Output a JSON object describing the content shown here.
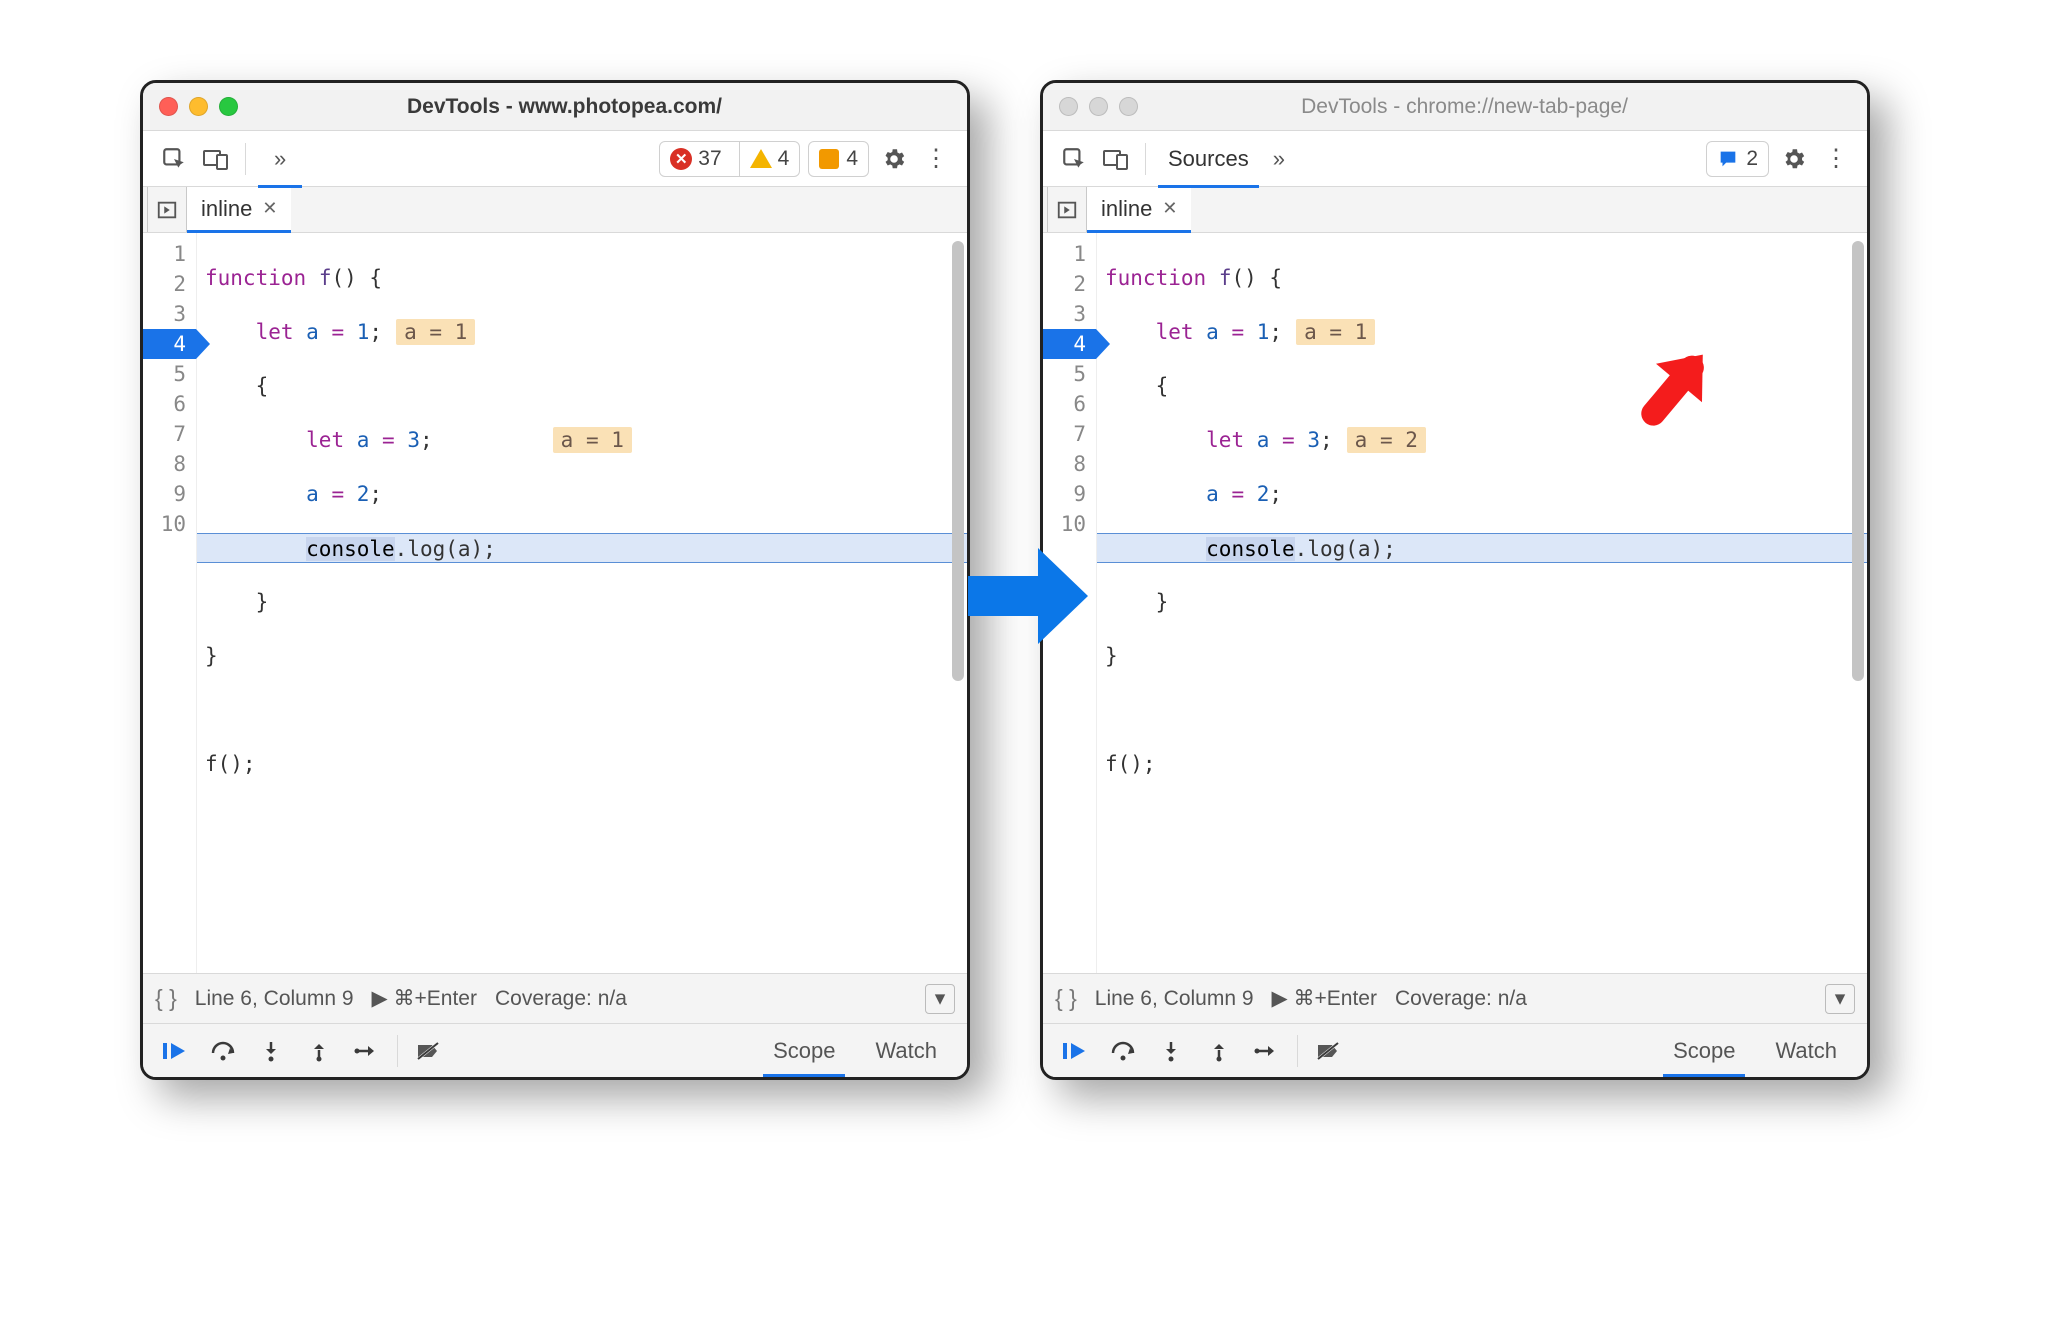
{
  "leftWindow": {
    "title": "DevTools - www.photopea.com/",
    "active": true,
    "toolbar": {
      "errors": "37",
      "warnings": "4",
      "issues": "4"
    },
    "tabLabel": "inline",
    "gutter": [
      "1",
      "2",
      "3",
      "4",
      "5",
      "6",
      "7",
      "8",
      "9",
      "10"
    ],
    "execLine": 4,
    "code": {
      "l1_kw": "function",
      "l1_fn": "f",
      "l1_rest": "() {",
      "l2_kw": "let",
      "l2_var": "a",
      "l2_eq": " = ",
      "l2_num": "1",
      "l2_semi": ";",
      "l2_hint": "a = 1",
      "l3": "{",
      "l4_kw": "let",
      "l4_var": "a",
      "l4_eq": " = ",
      "l4_num": "3",
      "l4_semi": ";",
      "l4_hint": "a = 1",
      "l5_var": "a",
      "l5_eq": " = ",
      "l5_num": "2",
      "l5_semi": ";",
      "l6_obj": "console",
      "l6_rest": ".log(a);",
      "l7": "}",
      "l8": "}",
      "l10": "f();"
    },
    "status": {
      "pos": "Line 6, Column 9",
      "run": "▶ ⌘+Enter",
      "coverage": "Coverage: n/a"
    },
    "dbgTabs": {
      "scope": "Scope",
      "watch": "Watch"
    }
  },
  "rightWindow": {
    "title": "DevTools - chrome://new-tab-page/",
    "active": false,
    "toolbar": {
      "sourcesTab": "Sources",
      "messages": "2"
    },
    "tabLabel": "inline",
    "gutter": [
      "1",
      "2",
      "3",
      "4",
      "5",
      "6",
      "7",
      "8",
      "9",
      "10"
    ],
    "execLine": 4,
    "code": {
      "l1_kw": "function",
      "l1_fn": "f",
      "l1_rest": "() {",
      "l2_kw": "let",
      "l2_var": "a",
      "l2_eq": " = ",
      "l2_num": "1",
      "l2_semi": ";",
      "l2_hint": "a = 1",
      "l3": "{",
      "l4_kw": "let",
      "l4_var": "a",
      "l4_eq": " = ",
      "l4_num": "3",
      "l4_semi": ";",
      "l4_hint": "a = 2",
      "l5_var": "a",
      "l5_eq": " = ",
      "l5_num": "2",
      "l5_semi": ";",
      "l6_obj": "console",
      "l6_rest": ".log(a);",
      "l7": "}",
      "l8": "}",
      "l10": "f();"
    },
    "status": {
      "pos": "Line 6, Column 9",
      "run": "▶ ⌘+Enter",
      "coverage": "Coverage: n/a"
    },
    "dbgTabs": {
      "scope": "Scope",
      "watch": "Watch"
    }
  }
}
